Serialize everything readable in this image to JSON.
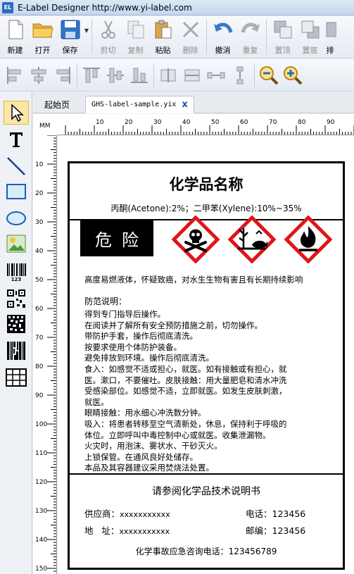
{
  "window": {
    "title": "E-Label Designer http://www.yi-label.com",
    "icon_text": "EL"
  },
  "toolbar": {
    "new": "新建",
    "open": "打开",
    "save": "保存",
    "cut": "剪切",
    "copy": "复制",
    "paste": "粘贴",
    "delete": "删除",
    "undo": "撤消",
    "redo": "重复",
    "bring_front": "置顶",
    "send_back": "置底",
    "more": "排"
  },
  "tabs": {
    "home": "起始页",
    "file": "GHS-label-sample.yix",
    "close": "x"
  },
  "ruler": {
    "unit": "MM"
  },
  "label": {
    "title": "化学品名称",
    "composition": "丙酮(Acetone):2%；二甲苯(Xylene):10%~35%",
    "signal_word": "危险",
    "hazard_statement": "高度易燃液体，怀疑致癌，对水生生物有害且有长期持续影响",
    "precaution_title": "防范说明：",
    "precautions": [
      "得到专门指导后操作。",
      "在阅读并了解所有安全预防措施之前，切勿操作。",
      "带防护手套，操作后彻底清洗。",
      "按要求使用个体防护装备。",
      "避免排放到环境。操作后彻底清洗。",
      "食入：如感觉不适或担心，就医。如有接触或有担心，就",
      "医。漱口，不要催吐。皮肤接触：用大量肥皂和清水冲洗",
      "受感染部位。如感觉不适，立即就医。如发生皮肤刺激，",
      "就医。",
      "眼睛接触：用水细心冲洗数分钟。",
      "吸入：将患者转移至空气清新处，休息，保持利于呼吸的",
      "体位。立即呼叫中毒控制中心或就医。收集泄漏物。",
      "火灾时，用泡沫、雾状水、干砂灭火。",
      "上锁保管。在通风良好处储存。",
      "本品及其容器建议采用焚烧法处置。"
    ],
    "reference": "请参阅化学品技术说明书",
    "supplier_label": "供应商：",
    "supplier_value": "xxxxxxxxxxx",
    "address_label": "地   址：",
    "address_value": "xxxxxxxxxxx",
    "phone_label": "电话：",
    "phone_value": "123456",
    "postcode_label": "邮编：",
    "postcode_value": "123456",
    "emergency": "化学事故应急咨询电话：123456789"
  },
  "colors": {
    "selected_tool": "#fbe7a6",
    "pictogram_red": "#e0141b",
    "tab_close": "#1c4fa8"
  },
  "icons": [
    "pointer-icon",
    "text-icon",
    "line-icon",
    "rectangle-icon",
    "ellipse-icon",
    "image-icon",
    "barcode-icon",
    "qrcode-icon",
    "datamatrix-icon",
    "pdf417-icon",
    "table-icon"
  ]
}
